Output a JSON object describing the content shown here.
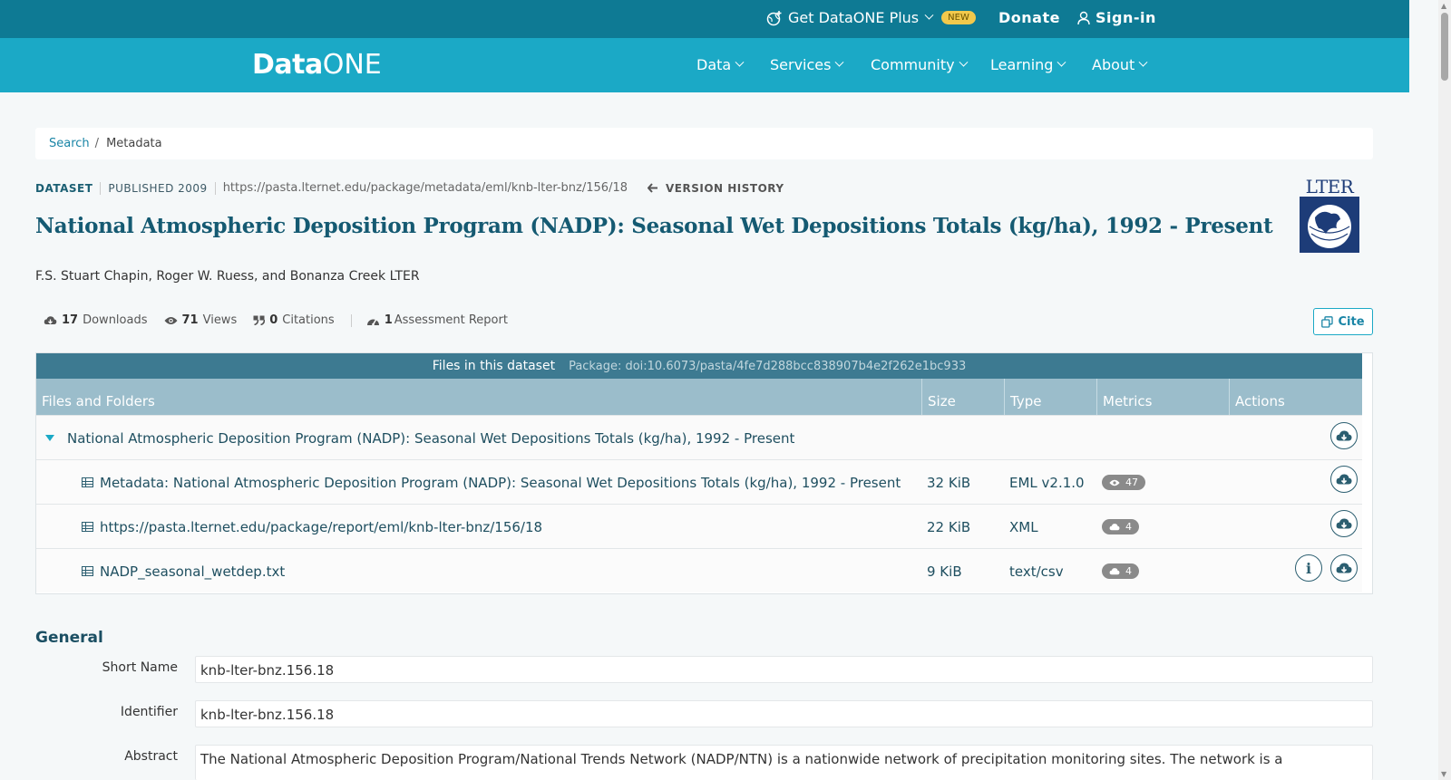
{
  "topbar": {
    "plus_label": "Get DataONE Plus",
    "new_badge": "NEW",
    "donate": "Donate",
    "signin": "Sign-in"
  },
  "nav": {
    "logo_data": "Data",
    "logo_one": "ONE",
    "items": [
      "Data",
      "Services",
      "Community",
      "Learning",
      "About"
    ]
  },
  "breadcrumb": {
    "search": "Search",
    "separator": "/",
    "current": "Metadata"
  },
  "dataset": {
    "type": "DATASET",
    "published": "PUBLISHED 2009",
    "url": "https://pasta.lternet.edu/package/metadata/eml/knb-lter-bnz/156/18",
    "version_history": "VERSION HISTORY",
    "title": "National Atmospheric Deposition Program (NADP): Seasonal Wet Depositions Totals (kg/ha), 1992 - Present",
    "authors": "F.S. Stuart Chapin, Roger W. Ruess, and Bonanza Creek LTER",
    "logo_text": "LTER"
  },
  "stats": {
    "downloads_count": "17",
    "downloads_label": "Downloads",
    "views_count": "71",
    "views_label": "Views",
    "citations_count": "0",
    "citations_label": "Citations",
    "assessment_count": "1",
    "assessment_label": "Assessment Report"
  },
  "cite_label": "Cite",
  "files": {
    "heading": "Files in this dataset",
    "package": "Package: doi:10.6073/pasta/4fe7d288bcc838907b4e2f262e1bc933",
    "columns": [
      "Files and Folders",
      "Size",
      "Type",
      "Metrics",
      "Actions"
    ],
    "folder": "National Atmospheric Deposition Program (NADP): Seasonal Wet Depositions Totals (kg/ha), 1992 - Present",
    "rows": [
      {
        "name": "Metadata: National Atmospheric Deposition Program (NADP): Seasonal Wet Depositions Totals (kg/ha), 1992 - Present",
        "size": "32 KiB",
        "type": "EML v2.1.0",
        "metric": "47",
        "metric_icon": "eye-icon"
      },
      {
        "name": "https://pasta.lternet.edu/package/report/eml/knb-lter-bnz/156/18",
        "size": "22 KiB",
        "type": "XML",
        "metric": "4",
        "metric_icon": "cloud-download-icon"
      },
      {
        "name": "NADP_seasonal_wetdep.txt",
        "size": "9 KiB",
        "type": "text/csv",
        "metric": "4",
        "metric_icon": "cloud-download-icon"
      }
    ]
  },
  "general": {
    "heading": "General",
    "short_name_label": "Short Name",
    "short_name": "knb-lter-bnz.156.18",
    "identifier_label": "Identifier",
    "identifier": "knb-lter-bnz.156.18",
    "abstract_label": "Abstract",
    "abstract": "The National Atmospheric Deposition Program/National Trends Network (NADP/NTN) is a nationwide network of precipitation monitoring sites. The network is a"
  },
  "colors": {
    "topbar": "#0e7a94",
    "navbar": "#1ba9c6",
    "title": "#155a72",
    "files_header": "#3d7a91",
    "column_header": "#9bbdcb"
  }
}
